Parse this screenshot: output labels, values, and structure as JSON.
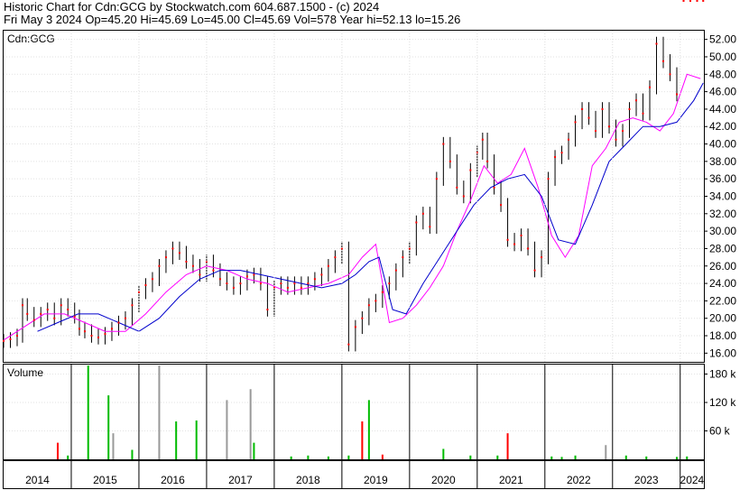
{
  "header": {
    "line1": "Historic Chart for Cdn:GCG by Stockwatch.com 604.687.1500 - (c) 2024",
    "line2": "Fri May  3 2024   Op=45.20  Hi=45.69  Lo=45.00  Cl=45.69  Vol=578  Year hi=52.13  lo=15.26"
  },
  "colors": {
    "price_bar": "#000000",
    "close_marker": "#ff0000",
    "ma_short": "#ff00ff",
    "ma_long": "#0000cc",
    "vol_up": "#00bb00",
    "vol_down": "#ff0000",
    "vol_neutral": "#999999"
  },
  "chart_data": [
    {
      "type": "line",
      "title": "Cdn:GCG",
      "ylim": [
        15,
        53
      ],
      "y_ticks": [
        16,
        18,
        20,
        22,
        24,
        26,
        28,
        30,
        32,
        34,
        36,
        38,
        40,
        42,
        44,
        46,
        48,
        50,
        52
      ],
      "y_tick_labels": [
        "16.00",
        "18.00",
        "20.00",
        "22.00",
        "24.00",
        "26.00",
        "28.00",
        "30.00",
        "32.00",
        "34.00",
        "36.00",
        "38.00",
        "40.00",
        "42.00",
        "44.00",
        "46.00",
        "48.00",
        "50.00",
        "52.00"
      ],
      "x_years": [
        "2014",
        "2015",
        "2016",
        "2017",
        "2018",
        "2019",
        "2020",
        "2021",
        "2022",
        "2023",
        "2024"
      ],
      "x_range": [
        2014.0,
        2024.35
      ],
      "series": [
        {
          "kind": "price",
          "x": [
            2014.0,
            2014.1,
            2014.2,
            2014.28,
            2014.35,
            2014.45,
            2014.55,
            2014.65,
            2014.75,
            2014.85,
            2014.95,
            2015.05,
            2015.12,
            2015.2,
            2015.3,
            2015.4,
            2015.5,
            2015.6,
            2015.7,
            2015.8,
            2015.9,
            2016.0,
            2016.1,
            2016.2,
            2016.3,
            2016.4,
            2016.5,
            2016.6,
            2016.7,
            2016.8,
            2016.9,
            2017.0,
            2017.1,
            2017.2,
            2017.3,
            2017.4,
            2017.5,
            2017.6,
            2017.7,
            2017.8,
            2017.9,
            2018.0,
            2018.1,
            2018.2,
            2018.3,
            2018.4,
            2018.5,
            2018.6,
            2018.7,
            2018.8,
            2018.9,
            2019.0,
            2019.1,
            2019.2,
            2019.3,
            2019.4,
            2019.5,
            2019.6,
            2019.7,
            2019.8,
            2019.9,
            2020.0,
            2020.1,
            2020.2,
            2020.3,
            2020.4,
            2020.5,
            2020.6,
            2020.7,
            2020.8,
            2020.9,
            2021.0,
            2021.08,
            2021.15,
            2021.25,
            2021.35,
            2021.45,
            2021.55,
            2021.65,
            2021.75,
            2021.85,
            2021.95,
            2022.05,
            2022.15,
            2022.25,
            2022.35,
            2022.45,
            2022.55,
            2022.65,
            2022.75,
            2022.85,
            2022.95,
            2023.05,
            2023.15,
            2023.25,
            2023.35,
            2023.45,
            2023.55,
            2023.65,
            2023.75,
            2023.85,
            2023.95,
            2024.05,
            2024.15,
            2024.25,
            2024.34
          ],
          "close": [
            17.4,
            17.6,
            18.0,
            21.5,
            20.5,
            19.8,
            20.5,
            21.0,
            20.0,
            21.5,
            21.0,
            20.2,
            18.8,
            18.5,
            18.0,
            17.8,
            18.2,
            18.8,
            19.5,
            20.0,
            21.5,
            23.0,
            23.8,
            24.5,
            26.0,
            27.0,
            28.0,
            27.5,
            26.5,
            26.0,
            25.0,
            26.5,
            25.5,
            24.5,
            24.0,
            23.5,
            24.0,
            24.8,
            25.0,
            24.0,
            21.0,
            23.5,
            24.0,
            23.5,
            24.0,
            23.5,
            24.0,
            24.5,
            25.0,
            26.0,
            27.0,
            28.0,
            17.0,
            19.0,
            20.0,
            21.5,
            22.0,
            23.0,
            24.0,
            25.5,
            27.0,
            28.0,
            31.0,
            32.0,
            30.5,
            36.0,
            40.0,
            38.0,
            35.0,
            34.0,
            37.0,
            39.0,
            40.5,
            38.0,
            35.0,
            33.0,
            29.0,
            28.5,
            29.5,
            28.0,
            25.5,
            27.0,
            36.0,
            38.5,
            39.0,
            40.5,
            42.5,
            44.0,
            43.0,
            41.5,
            44.0,
            42.0,
            40.5,
            41.5,
            44.0,
            45.0,
            43.5,
            46.5,
            51.5,
            49.5,
            48.0,
            45.7
          ]
        },
        {
          "kind": "ma_short",
          "name": "short moving average",
          "x": [
            2014.0,
            2014.3,
            2014.6,
            2014.9,
            2015.2,
            2015.5,
            2015.8,
            2016.1,
            2016.4,
            2016.7,
            2017.0,
            2017.3,
            2017.6,
            2017.9,
            2018.2,
            2018.5,
            2018.8,
            2019.1,
            2019.3,
            2019.5,
            2019.7,
            2019.9,
            2020.1,
            2020.3,
            2020.5,
            2020.7,
            2020.9,
            2021.1,
            2021.3,
            2021.5,
            2021.7,
            2021.9,
            2022.1,
            2022.3,
            2022.5,
            2022.7,
            2022.9,
            2023.1,
            2023.3,
            2023.5,
            2023.7,
            2023.9,
            2024.1,
            2024.3
          ],
          "values": [
            17.5,
            19.0,
            20.5,
            20.5,
            19.5,
            18.5,
            18.5,
            20.5,
            23.0,
            25.0,
            26.0,
            25.5,
            24.5,
            24.0,
            23.0,
            23.5,
            24.0,
            25.0,
            27.0,
            28.5,
            19.5,
            20.0,
            21.5,
            23.5,
            26.0,
            30.0,
            33.5,
            37.5,
            35.5,
            36.5,
            39.5,
            35.0,
            29.5,
            27.0,
            29.5,
            37.5,
            39.5,
            42.5,
            43.0,
            42.5,
            41.5,
            43.5,
            48.0,
            47.5
          ]
        },
        {
          "kind": "ma_long",
          "name": "long moving average",
          "x": [
            2014.5,
            2014.8,
            2015.1,
            2015.4,
            2015.7,
            2016.0,
            2016.3,
            2016.6,
            2016.9,
            2017.2,
            2017.5,
            2017.8,
            2018.1,
            2018.4,
            2018.7,
            2019.0,
            2019.2,
            2019.4,
            2019.55,
            2019.75,
            2019.95,
            2020.2,
            2020.45,
            2020.7,
            2020.95,
            2021.2,
            2021.45,
            2021.7,
            2021.95,
            2022.2,
            2022.45,
            2022.7,
            2022.95,
            2023.2,
            2023.45,
            2023.7,
            2023.95,
            2024.2,
            2024.34
          ],
          "values": [
            18.5,
            19.5,
            20.5,
            20.5,
            19.5,
            18.5,
            20.0,
            22.5,
            24.5,
            25.5,
            25.5,
            25.0,
            24.5,
            24.0,
            23.5,
            24.0,
            25.0,
            26.5,
            27.0,
            21.0,
            20.5,
            24.0,
            27.0,
            30.0,
            33.0,
            35.0,
            36.0,
            36.5,
            34.0,
            29.0,
            28.5,
            33.0,
            38.0,
            40.0,
            42.0,
            42.0,
            42.5,
            45.0,
            47.0
          ]
        }
      ]
    },
    {
      "type": "bar",
      "title": "Volume",
      "ylim": [
        0,
        200000
      ],
      "y_ticks": [
        60000,
        120000,
        180000
      ],
      "y_tick_labels": [
        "60 k",
        "120 k",
        "180 k"
      ],
      "x_range": [
        2014.0,
        2024.35
      ],
      "series": [
        {
          "kind": "spikes",
          "x": [
            2014.8,
            2014.95,
            2015.25,
            2015.55,
            2015.62,
            2015.9,
            2016.3,
            2016.55,
            2016.85,
            2017.3,
            2017.65,
            2017.7,
            2018.25,
            2018.5,
            2018.8,
            2019.1,
            2019.3,
            2019.4,
            2019.6,
            2020.5,
            2020.9,
            2021.3,
            2021.45,
            2022.1,
            2022.25,
            2022.45,
            2022.9,
            2023.2,
            2023.5,
            2023.95,
            2024.1
          ],
          "values": [
            35000,
            8000,
            210000,
            135000,
            55000,
            20000,
            198000,
            80000,
            82000,
            125000,
            148000,
            35000,
            6000,
            8000,
            6000,
            8000,
            80000,
            125000,
            10000,
            22000,
            8000,
            8000,
            55000,
            6000,
            5000,
            8000,
            30000,
            8000,
            6000,
            5000,
            6000
          ],
          "color_keys": [
            "vol_down",
            "vol_up",
            "vol_up",
            "vol_up",
            "vol_neutral",
            "vol_up",
            "vol_neutral",
            "vol_up",
            "vol_up",
            "vol_neutral",
            "vol_neutral",
            "vol_up",
            "vol_up",
            "vol_up",
            "vol_up",
            "vol_up",
            "vol_down",
            "vol_up",
            "vol_down",
            "vol_up",
            "vol_up",
            "vol_up",
            "vol_down",
            "vol_up",
            "vol_up",
            "vol_up",
            "vol_neutral",
            "vol_up",
            "vol_up",
            "vol_up",
            "vol_up"
          ]
        }
      ]
    }
  ]
}
